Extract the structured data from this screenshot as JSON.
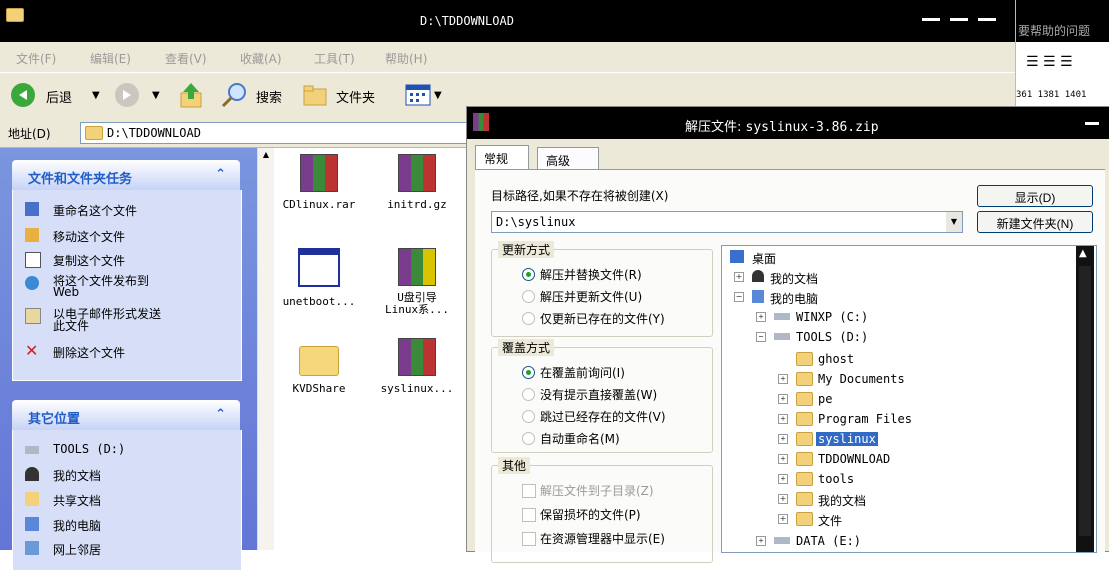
{
  "explorer": {
    "title": "D:\\TDDOWNLOAD",
    "menu": [
      "文件(F)",
      "编辑(E)",
      "查看(V)",
      "收藏(A)",
      "工具(T)",
      "帮助(H)"
    ],
    "toolbar": {
      "back": "后退",
      "search": "搜索",
      "folders": "文件夹"
    },
    "address_label": "地址(D)",
    "address_value": "D:\\TDDOWNLOAD",
    "tasks_panel": {
      "title": "文件和文件夹任务",
      "items": [
        "重命名这个文件",
        "移动这个文件",
        "复制这个文件",
        "将这个文件发布到\nWeb",
        "以电子邮件形式发送\n此文件",
        "删除这个文件"
      ]
    },
    "places_panel": {
      "title": "其它位置",
      "items": [
        "TOOLS (D:)",
        "我的文档",
        "共享文档",
        "我的电脑",
        "网上邻居"
      ]
    },
    "files": [
      "CDlinux.rar",
      "initrd.gz",
      "unetboot...",
      "U盘引导\nLinux系...",
      "KVDShare",
      "syslinux..."
    ]
  },
  "right_app": {
    "text": "要帮助的问题",
    "ruler": "361  1381  1401"
  },
  "dialog": {
    "title_prefix": "解压文件:",
    "title_file": "syslinux-3.86.zip",
    "tabs": [
      "常规",
      "高级"
    ],
    "target_label": "目标路径,如果不存在将被创建(X)",
    "target_value": "D:\\syslinux",
    "show_button": "显示(D)",
    "newfolder_button": "新建文件夹(N)",
    "update_group": {
      "title": "更新方式",
      "options": [
        "解压并替换文件(R)",
        "解压并更新文件(U)",
        "仅更新已存在的文件(Y)"
      ],
      "selected": 0
    },
    "overwrite_group": {
      "title": "覆盖方式",
      "options": [
        "在覆盖前询问(I)",
        "没有提示直接覆盖(W)",
        "跳过已经存在的文件(V)",
        "自动重命名(M)"
      ],
      "selected": 0
    },
    "misc_group": {
      "title": "其他",
      "options": [
        "解压文件到子目录(Z)",
        "保留损坏的文件(P)",
        "在资源管理器中显示(E)"
      ]
    },
    "tree": {
      "desktop": "桌面",
      "mydocs": "我的文档",
      "mycomputer": "我的电脑",
      "winxp": "WINXP (C:)",
      "tools": "TOOLS (D:)",
      "folders": [
        "ghost",
        "My Documents",
        "pe",
        "Program Files",
        "syslinux",
        "TDDOWNLOAD",
        "tools",
        "我的文档",
        "文件"
      ],
      "data": "DATA (E:)",
      "selected": "syslinux"
    }
  }
}
